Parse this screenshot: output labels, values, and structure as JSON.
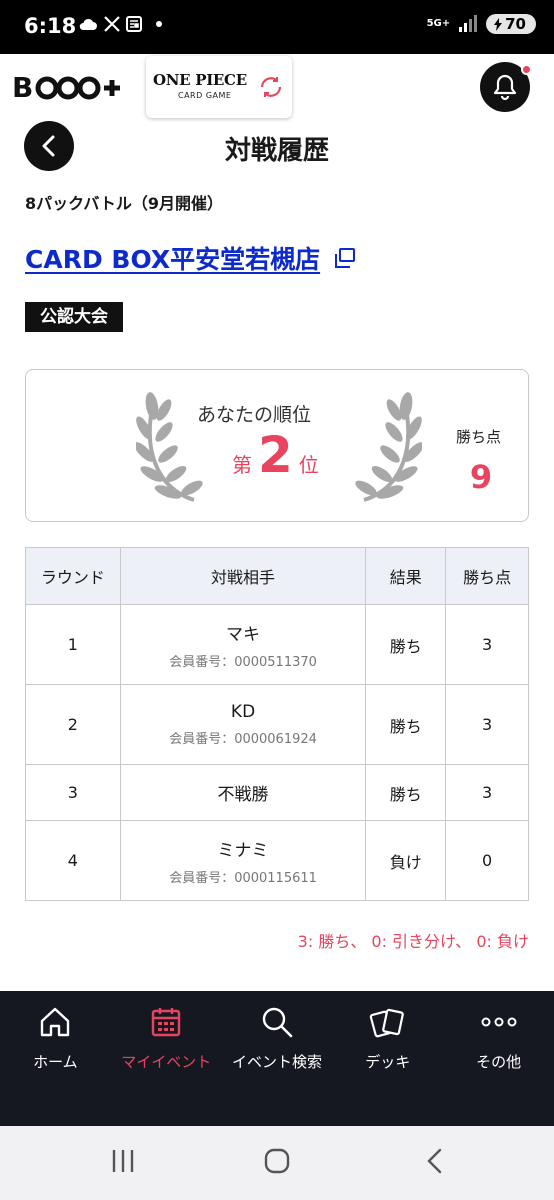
{
  "status_bar": {
    "time": "6:18",
    "network": "5G+",
    "battery": "70"
  },
  "header": {
    "app_logo": "B•CG+",
    "game_logo_title": "ONE PIECE",
    "game_logo_sub": "CARD GAME"
  },
  "page": {
    "title": "対戦履歴",
    "event_name": "8パックバトル（9月開催）",
    "store_name": "CARD BOX平安堂若槻店",
    "badge": "公認大会"
  },
  "rank": {
    "label": "あなたの順位",
    "prefix": "第",
    "value": "2",
    "suffix": "位",
    "points_label": "勝ち点",
    "points": "9"
  },
  "table": {
    "headers": [
      "ラウンド",
      "対戦相手",
      "結果",
      "勝ち点"
    ],
    "rows": [
      {
        "round": "1",
        "opponent": "マキ",
        "member": "会員番号：0000511370",
        "result": "勝ち",
        "points": "3"
      },
      {
        "round": "2",
        "opponent": "KD",
        "member": "会員番号：0000061924",
        "result": "勝ち",
        "points": "3"
      },
      {
        "round": "3",
        "opponent": "不戦勝",
        "member": "",
        "result": "勝ち",
        "points": "3"
      },
      {
        "round": "4",
        "opponent": "ミナミ",
        "member": "会員番号：0000115611",
        "result": "負け",
        "points": "0"
      }
    ]
  },
  "legend": "3: 勝ち、 0: 引き分け、 0: 負け",
  "bottom_nav": [
    {
      "label": "ホーム",
      "icon": "home-icon",
      "active": false
    },
    {
      "label": "マイイベント",
      "icon": "calendar-icon",
      "active": true
    },
    {
      "label": "イベント検索",
      "icon": "search-icon",
      "active": false
    },
    {
      "label": "デッキ",
      "icon": "cards-icon",
      "active": false
    },
    {
      "label": "その他",
      "icon": "more-icon",
      "active": false
    }
  ],
  "colors": {
    "accent": "#e8445f",
    "link": "#0d2bcc",
    "nav_bg": "#151821"
  }
}
